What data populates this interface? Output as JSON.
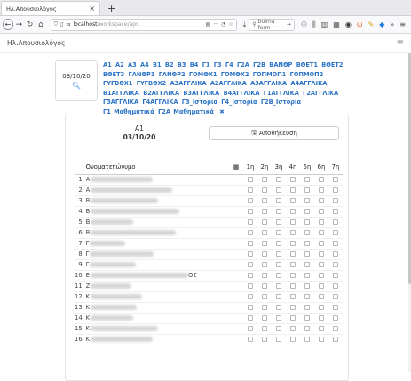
{
  "browser": {
    "tab_title": "Ηλ.Απουσιολόγος",
    "url_host": "localhost",
    "url_path": "/workspace/aps",
    "search_placeholder": "bulma form",
    "close_glyph": "×",
    "newtab_glyph": "+",
    "go_glyph": "→"
  },
  "app": {
    "brand": "Ηλ.Απουσιολόγος"
  },
  "filter": {
    "date": "03/10/20",
    "classes": [
      "A1",
      "A2",
      "A3",
      "A4",
      "B1",
      "B2",
      "B3",
      "B4",
      "Γ1",
      "Γ3",
      "Γ4",
      "Γ2A",
      "Γ2B",
      "BANΘP",
      "BΘET1",
      "BΘET2",
      "BΘET3",
      "ΓANΘP1",
      "ΓANΘP2",
      "ΓOMΘX1",
      "ΓOMΘX2",
      "ΓOΠMOΠ1",
      "ΓOΠMOΠ2",
      "ΓYΓBΘX1",
      "ΓYΓBΘX2",
      "A3AΓΓΛIKA",
      "A2AΓΓΛIKA",
      "A3AΓΓΛIKA",
      "A4AΓΓΛIKA",
      "B1AΓΓΛIKA",
      "B2AΓΓΛIKA",
      "B3AΓΓΛIKA",
      "B4AΓΓΛIKA",
      "Γ1AΓΓΛIKA",
      "Γ2AΓΓΛIKA",
      "Γ3AΓΓΛIKA",
      "Γ4AΓΓΛIKA",
      "Γ3_Ιστορία",
      "Γ4_Ιστορία",
      "Γ2B_Ιστορία",
      "Γ1_Μαθηματικά",
      "Γ2A_Μαθηματικά"
    ],
    "clear_glyph": "✖"
  },
  "sheet": {
    "class_name": "A1",
    "date": "03/10/20",
    "save_label": "Αποθήκευση",
    "col_name": "Ονοματεπώνυμο",
    "hours": [
      "1η",
      "2η",
      "3η",
      "4η",
      "5η",
      "6η",
      "7η"
    ],
    "rows": [
      {
        "n": "1",
        "initial": "A",
        "w": 70
      },
      {
        "n": "2",
        "initial": "A",
        "w": 92
      },
      {
        "n": "3",
        "initial": "B",
        "w": 76
      },
      {
        "n": "4",
        "initial": "B",
        "w": 100
      },
      {
        "n": "5",
        "initial": "B",
        "w": 48
      },
      {
        "n": "6",
        "initial": "B",
        "w": 96
      },
      {
        "n": "7",
        "initial": "Γ",
        "w": 40
      },
      {
        "n": "8",
        "initial": "Γ",
        "w": 72
      },
      {
        "n": "9",
        "initial": "Γ",
        "w": 52
      },
      {
        "n": "10",
        "initial": "E",
        "w": 110,
        "suffix": "ΟΣ"
      },
      {
        "n": "11",
        "initial": "Z",
        "w": 46
      },
      {
        "n": "12",
        "initial": "K",
        "w": 58
      },
      {
        "n": "13",
        "initial": "K",
        "w": 52
      },
      {
        "n": "14",
        "initial": "K",
        "w": 48
      },
      {
        "n": "15",
        "initial": "K",
        "w": 76
      },
      {
        "n": "16",
        "initial": "K",
        "w": 70
      }
    ]
  }
}
